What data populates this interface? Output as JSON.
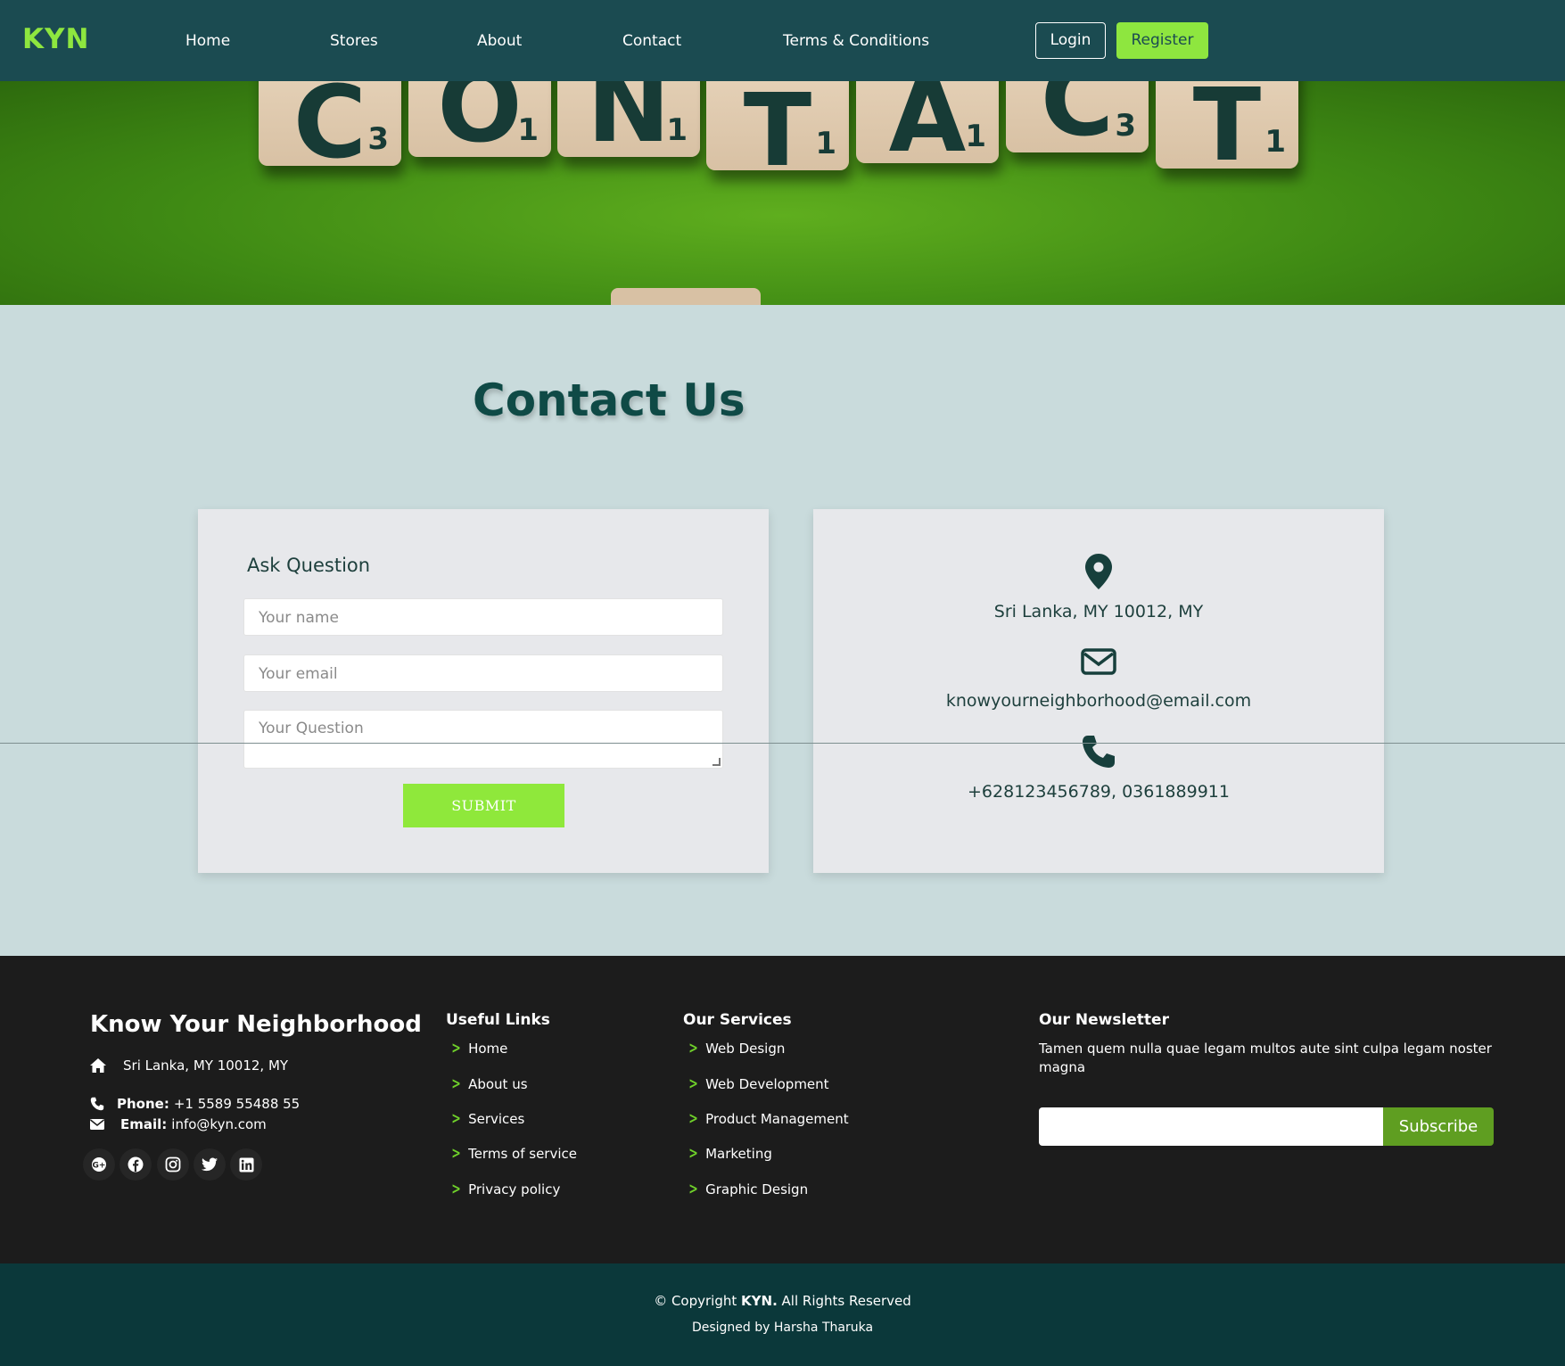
{
  "nav": {
    "logo": "KYN",
    "links": [
      "Home",
      "Stores",
      "About",
      "Contact",
      "Terms & Conditions"
    ],
    "login": "Login",
    "register": "Register"
  },
  "hero": {
    "tiles": [
      {
        "letter": "C",
        "points": "3"
      },
      {
        "letter": "O",
        "points": "1"
      },
      {
        "letter": "N",
        "points": "1"
      },
      {
        "letter": "T",
        "points": "1"
      },
      {
        "letter": "A",
        "points": "1"
      },
      {
        "letter": "C",
        "points": "3"
      },
      {
        "letter": "T",
        "points": "1"
      }
    ]
  },
  "contact": {
    "title": "Contact Us",
    "form": {
      "title": "Ask Question",
      "name_placeholder": "Your name",
      "email_placeholder": "Your email",
      "question_placeholder": "Your Question",
      "submit": "SUBMIT"
    },
    "info": {
      "address": "Sri Lanka, MY 10012, MY",
      "email": "knowyourneighborhood@email.com",
      "phone": "+628123456789, 0361889911"
    }
  },
  "footer": {
    "brand": "Know Your Neighborhood",
    "address": "Sri Lanka, MY 10012, MY",
    "phone_label": "Phone:",
    "phone": "+1 5589 55488 55",
    "email_label": "Email:",
    "email": "info@kyn.com",
    "social_icons": [
      "google-plus-icon",
      "facebook-icon",
      "instagram-icon",
      "twitter-icon",
      "linkedin-icon"
    ],
    "useful_links": {
      "title": "Useful Links",
      "items": [
        "Home",
        "About us",
        "Services",
        "Terms of service",
        "Privacy policy"
      ]
    },
    "services": {
      "title": "Our Services",
      "items": [
        "Web Design",
        "Web Development",
        "Product Management",
        "Marketing",
        "Graphic Design"
      ]
    },
    "newsletter": {
      "title": "Our Newsletter",
      "text": "Tamen quem nulla quae legam multos aute sint culpa legam noster magna",
      "button": "Subscribe"
    }
  },
  "copyright": {
    "prefix": "© Copyright ",
    "brand": "KYN.",
    "suffix": " All Rights Reserved",
    "designed_prefix": "Designed by ",
    "designer": "Harsha Tharuka"
  },
  "colors": {
    "nav_bg": "#1b4b51",
    "accent_green": "#8ee63f",
    "page_bg": "#c9dbdc",
    "footer_bg": "#1c1c1c",
    "copyright_bg": "#0b383a"
  }
}
